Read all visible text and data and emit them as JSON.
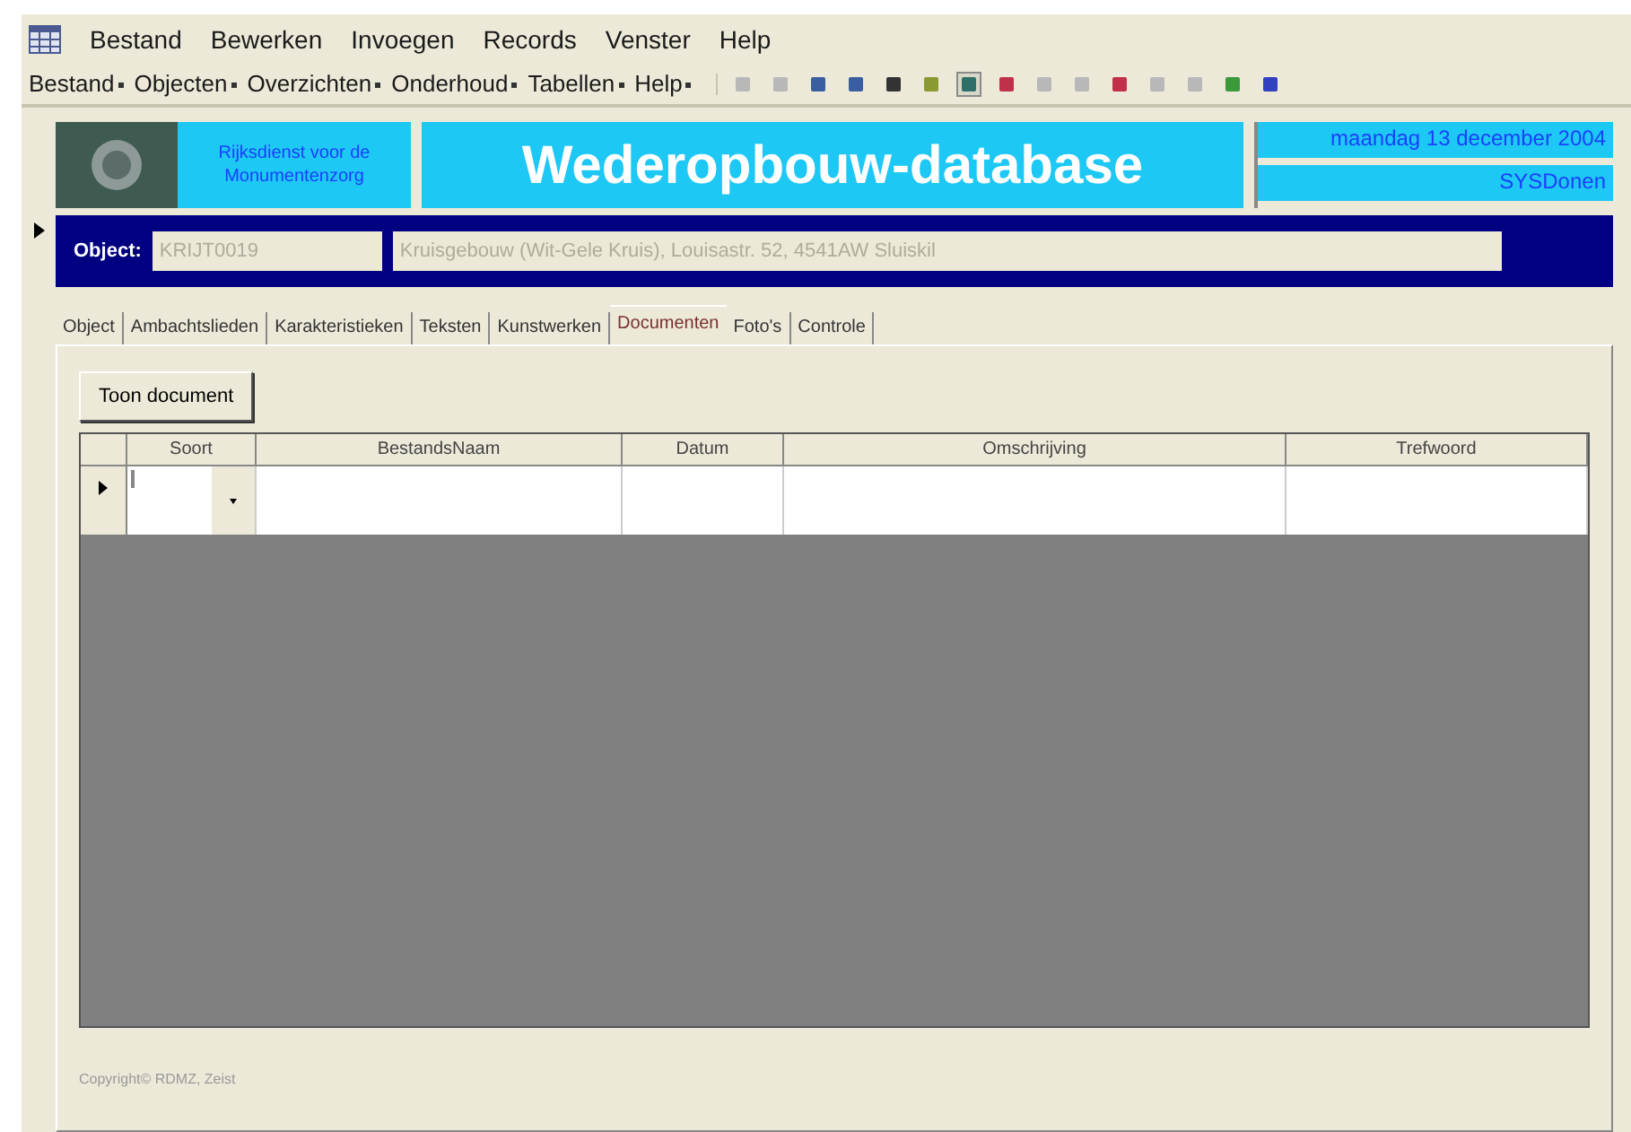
{
  "menu_bar": [
    "Bestand",
    "Bewerken",
    "Invoegen",
    "Records",
    "Venster",
    "Help"
  ],
  "toolbar": {
    "menus": [
      "Bestand",
      "Objecten",
      "Overzichten",
      "Onderhoud",
      "Tabellen",
      "Help"
    ]
  },
  "header": {
    "organization": "Rijksdienst voor de Monumentenzorg",
    "title": "Wederopbouw-database",
    "date": "maandag 13 december 2004",
    "user": "SYSDonen"
  },
  "object_bar": {
    "label": "Object:",
    "code": "KRIJT0019",
    "description": "Kruisgebouw (Wit-Gele Kruis), Louisastr. 52, 4541AW Sluiskil"
  },
  "tabs": [
    {
      "label": "Object",
      "selected": false
    },
    {
      "label": "Ambachtslieden",
      "selected": false
    },
    {
      "label": "Karakteristieken",
      "selected": false
    },
    {
      "label": "Teksten",
      "selected": false
    },
    {
      "label": "Kunstwerken",
      "selected": false
    },
    {
      "label": "Documenten",
      "selected": true
    },
    {
      "label": "Foto's",
      "selected": false
    },
    {
      "label": "Controle",
      "selected": false
    }
  ],
  "show_document_button": "Toon document",
  "table": {
    "columns": [
      "Soort",
      "BestandsNaam",
      "Datum",
      "Omschrijving",
      "Trefwoord"
    ]
  },
  "copyright": "Copyright© RDMZ, Zeist"
}
